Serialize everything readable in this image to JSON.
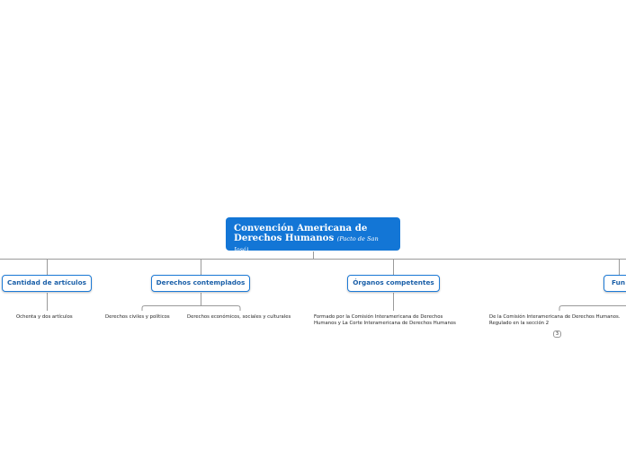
{
  "root": {
    "title_line1": "Convención Americana de",
    "title_line2": "Derechos Humanos",
    "subtitle": "(Pacto de San José)"
  },
  "topics": {
    "cantidad": {
      "label": "Cantidad de artículos",
      "leaves": [
        "Ochenta y dos artículos"
      ]
    },
    "derechos": {
      "label": "Derechos contemplados",
      "leaves": [
        "Derechos civiles y políticos",
        "Derechos económicos, sociales y culturales"
      ]
    },
    "organos": {
      "label": "Órganos competentes",
      "leaves": [
        "Formado por la Comisión Interamericana de Derechos Humanos y La Corte Interamericana de Derechos Humanos"
      ],
      "leaf_line1": "Formado por la Comisión Interamericana de Derechos",
      "leaf_line2": "Humanos y La Corte Interamericana de Derechos Humanos"
    },
    "funciones": {
      "label": "Fun",
      "leaf_line1": "De la Comisión Interamericana de Derechos Humanos.",
      "leaf_line2": "Regulado en la sección 2",
      "badge": "3"
    }
  },
  "colors": {
    "root_fill": "#1376d6",
    "topic_border": "#1d7ad6",
    "topic_text": "#1a5fa8",
    "connector": "#9a9a9a"
  }
}
